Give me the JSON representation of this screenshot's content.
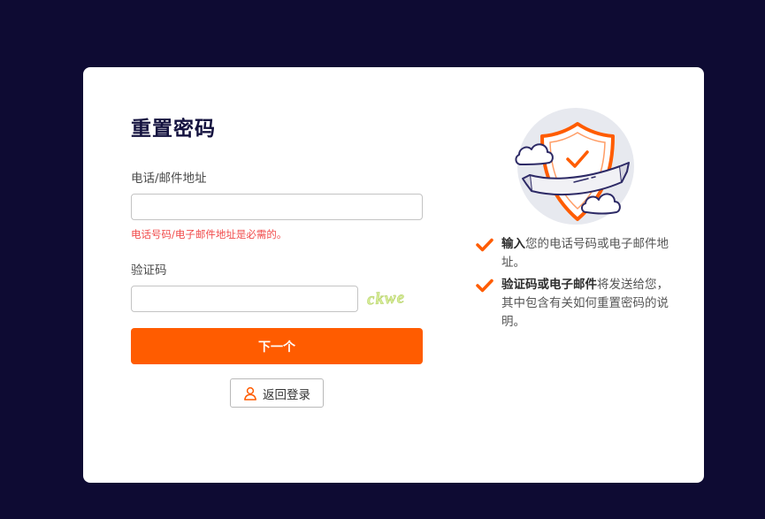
{
  "page": {
    "title": "重置密码"
  },
  "form": {
    "contact_label": "电话/邮件地址",
    "contact_value": "",
    "contact_error": "电话号码/电子邮件地址是必需的。",
    "code_label": "验证码",
    "code_value": "",
    "captcha_text": "ckwe",
    "next_label": "下一个",
    "back_label": "返回登录"
  },
  "info": {
    "items": [
      {
        "bold": "输入",
        "text": "您的电话号码或电子邮件地址。"
      },
      {
        "bold": "验证码或电子邮件",
        "text": "将发送给您，其中包含有关如何重置密码的说明。"
      }
    ]
  },
  "colors": {
    "background": "#0e0b33",
    "accent": "#ff5c00",
    "error": "#f14c4c",
    "title": "#14123f"
  },
  "icons": {
    "illustration": "shield-cloud-illustration",
    "check": "check-icon",
    "user": "user-icon"
  }
}
